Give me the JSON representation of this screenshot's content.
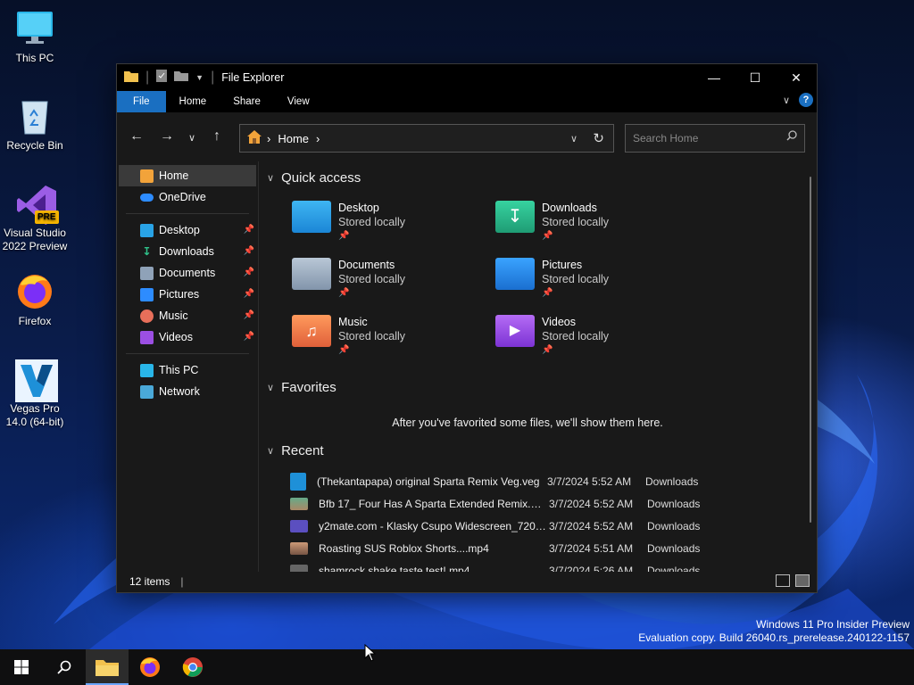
{
  "desktop": {
    "icons": [
      {
        "label": "This PC"
      },
      {
        "label": "Recycle Bin"
      },
      {
        "label": "Visual Studio 2022 Preview",
        "badge": "PRE"
      },
      {
        "label": "Firefox"
      },
      {
        "label": "Vegas Pro 14.0 (64-bit)"
      }
    ]
  },
  "window": {
    "title": "File Explorer",
    "ribbon_tabs": [
      "File",
      "Home",
      "Share",
      "View"
    ],
    "address": {
      "crumb": "Home"
    },
    "search": {
      "placeholder": "Search Home"
    },
    "sidebar": {
      "top": [
        {
          "label": "Home"
        },
        {
          "label": "OneDrive"
        }
      ],
      "pinned": [
        {
          "label": "Desktop"
        },
        {
          "label": "Downloads"
        },
        {
          "label": "Documents"
        },
        {
          "label": "Pictures"
        },
        {
          "label": "Music"
        },
        {
          "label": "Videos"
        }
      ],
      "bottom": [
        {
          "label": "This PC"
        },
        {
          "label": "Network"
        }
      ]
    },
    "quick_access": {
      "heading": "Quick access",
      "items": [
        {
          "name": "Desktop",
          "sub": "Stored locally"
        },
        {
          "name": "Downloads",
          "sub": "Stored locally"
        },
        {
          "name": "Documents",
          "sub": "Stored locally"
        },
        {
          "name": "Pictures",
          "sub": "Stored locally"
        },
        {
          "name": "Music",
          "sub": "Stored locally"
        },
        {
          "name": "Videos",
          "sub": "Stored locally"
        }
      ]
    },
    "favorites": {
      "heading": "Favorites",
      "empty": "After you've favorited some files, we'll show them here."
    },
    "recent": {
      "heading": "Recent",
      "rows": [
        {
          "name": "(Thekantapapa) original Sparta Remix Veg.veg",
          "date": "3/7/2024 5:52 AM",
          "location": "Downloads"
        },
        {
          "name": "Bfb 17_ Four Has A Sparta Extended Remix.mp4",
          "date": "3/7/2024 5:52 AM",
          "location": "Downloads"
        },
        {
          "name": "y2mate.com - Klasky Csupo Widescreen_720p....",
          "date": "3/7/2024 5:52 AM",
          "location": "Downloads"
        },
        {
          "name": "Roasting SUS Roblox Shorts....mp4",
          "date": "3/7/2024 5:51 AM",
          "location": "Downloads"
        },
        {
          "name": "shamrock shake taste test!.mp4",
          "date": "3/7/2024 5:26 AM",
          "location": "Downloads"
        }
      ]
    },
    "status": {
      "count": "12 items"
    }
  },
  "watermark": {
    "line1": "Windows 11 Pro Insider Preview",
    "line2": "Evaluation copy. Build 26040.rs_prerelease.240122-1157"
  },
  "colors": {
    "accent": "#1a6fc1",
    "window_bg": "#191919",
    "titlebar": "#000000"
  }
}
